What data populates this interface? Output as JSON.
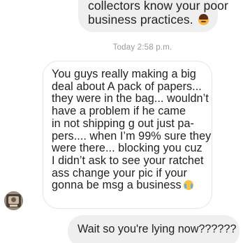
{
  "thread": {
    "outgoing_top": {
      "lines": [
        "collectors know your poor",
        "business practices."
      ],
      "emoji": "woman-face-emoji"
    },
    "timestamp": "Today 2:58 p.m.",
    "incoming": {
      "lines": [
        "You guys really making a big",
        "deal about A pack of papers...",
        "they were in the bag... wouldn’t",
        "have a problem if he came",
        "in not shipping g out just pa-",
        "pers.... when I’m 99% sure they",
        "were there... blocking you cuz",
        "I didn’t ask to see your ratchet",
        "ass change your pic if your",
        "gonna be msg a business"
      ],
      "emoji": "crying-face-emoji"
    },
    "outgoing_bottom": {
      "lines": [
        "Wait so you're lying now??????"
      ]
    }
  },
  "colors": {
    "outgoing_bubble": "#efefef",
    "incoming_border": "#e6e6e6",
    "timestamp": "#9a9a9a",
    "text": "#1f1f1f"
  }
}
